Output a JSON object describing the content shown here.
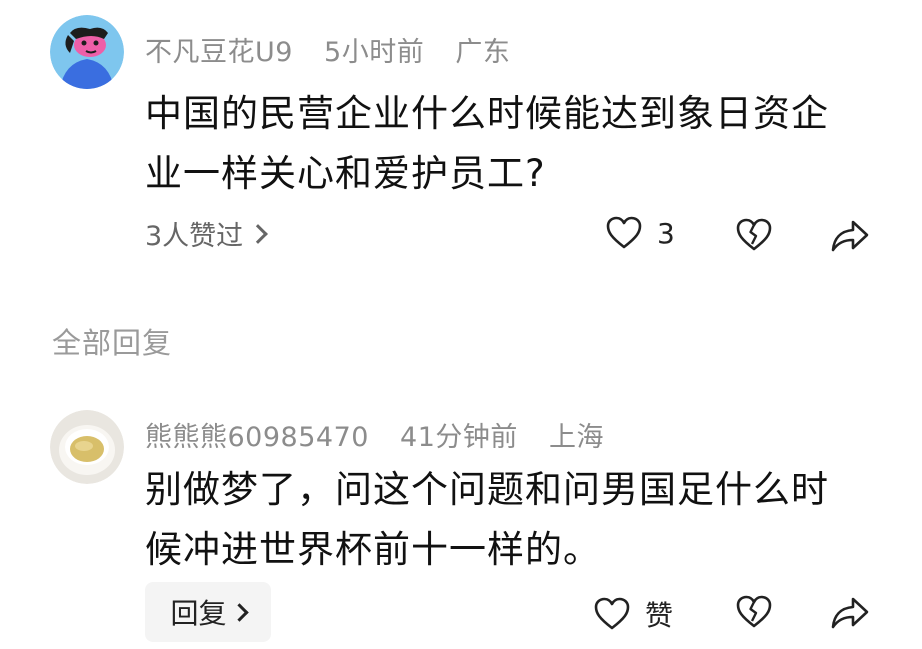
{
  "comment": {
    "username": "不凡豆花U9",
    "time": "5小时前",
    "location": "广东",
    "content": "中国的民营企业什么时候能达到象日资企业一样关心和爱护员工?",
    "likes_summary": "3人赞过",
    "like_count": "3"
  },
  "replies_section": {
    "title": "全部回复"
  },
  "reply": {
    "username": "熊熊熊60985470",
    "time": "41分钟前",
    "location": "上海",
    "content": "别做梦了，问这个问题和问男国足什么时候冲进世界杯前十一样的。",
    "like_label": "赞",
    "reply_button_label": "回复"
  },
  "icons": {
    "like": "heart-outline-icon",
    "dislike": "broken-heart-icon",
    "share": "share-arrow-icon",
    "chevron": "chevron-right-icon"
  },
  "colors": {
    "avatar1_bg": "#7ec6ee",
    "avatar1_figure": "#3a6ee0",
    "avatar1_face": "#ee5fa8"
  }
}
